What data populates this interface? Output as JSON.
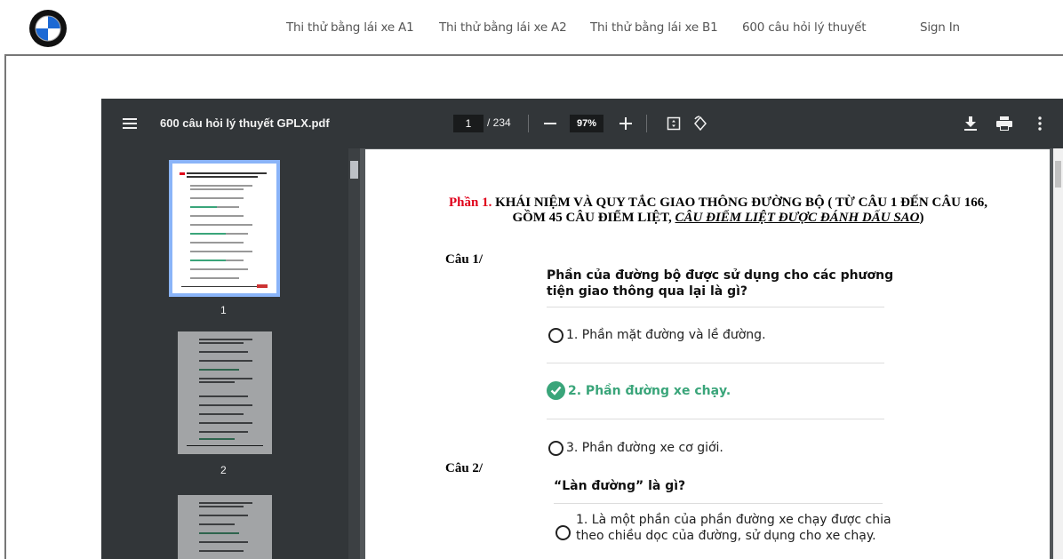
{
  "site_nav": {
    "links": [
      "Thi thử bằng lái xe A1",
      "Thi thử bằng lái xe A2",
      "Thi thử bằng lái xe B1",
      "600 câu hỏi lý thuyết"
    ],
    "sign_in": "Sign In"
  },
  "viewer": {
    "file_name": "600 câu hỏi lý thuyết GPLX.pdf",
    "current_page": "1",
    "total_pages": "/ 234",
    "zoom": "97%",
    "thumbnails": [
      "1",
      "2"
    ]
  },
  "document": {
    "title_prefix": "Phần 1.",
    "title_main": " KHÁI NIỆM VÀ QUY TẮC GIAO THÔNG ĐƯỜNG BỘ ( TỪ CÂU 1 ĐẾN CÂU 166, GỒM 45 CÂU ĐIỂM LIỆT, ",
    "title_underlined": "CÂU ĐIỂM LIỆT ĐƯỢC ĐÁNH DẤU SAO",
    "title_suffix": ")",
    "questions": [
      {
        "label": "Câu 1/",
        "text": "Phần của đường bộ được sử dụng cho các phương tiện giao thông qua lại là gì?",
        "answers": [
          "1. Phần mặt đường và lề đường.",
          "2. Phần đường xe chạy.",
          "3. Phần đường xe cơ giới."
        ],
        "correct_answer": "2. Phần đường xe chạy."
      },
      {
        "label": "Câu 2/",
        "text": "“Làn đường” là gì?",
        "answers": [
          "1. Là một phần của phần đường xe chạy được chia theo chiều dọc của đường, sử dụng cho xe chạy."
        ]
      }
    ]
  },
  "colors": {
    "toolbar": "#323639",
    "background": "#525659",
    "correct": "#3aa57a",
    "title_red": "#e0001a"
  }
}
